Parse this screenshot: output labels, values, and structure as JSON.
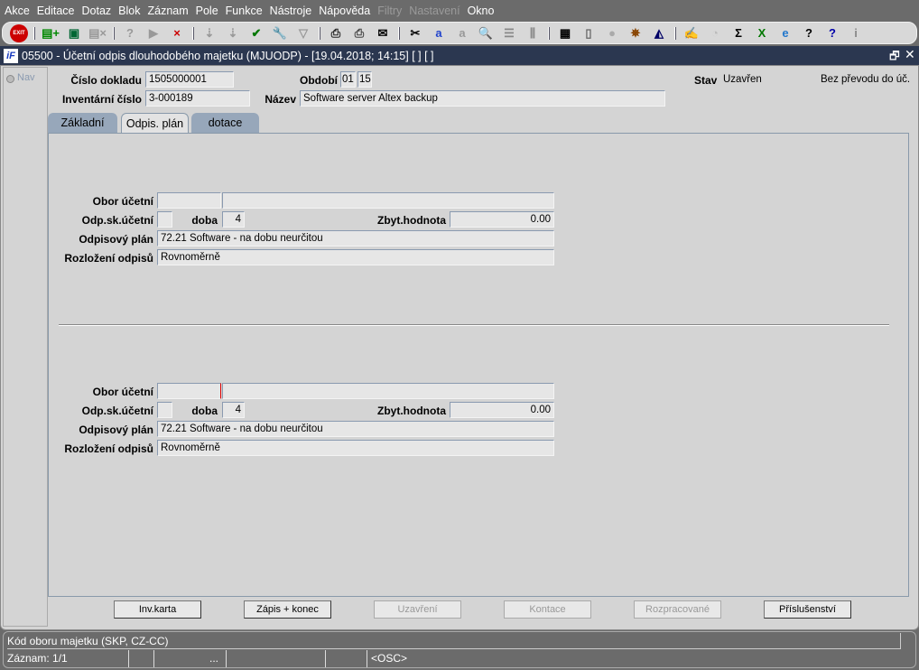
{
  "menu": [
    "Akce",
    "Editace",
    "Dotaz",
    "Blok",
    "Záznam",
    "Pole",
    "Funkce",
    "Nástroje",
    "Nápověda",
    "Filtry",
    "Nastavení",
    "Okno"
  ],
  "toolbar_icons": [
    "exit-icon",
    "sep",
    "insert-record-icon",
    "save-record-icon",
    "delete-record-icon",
    "sep",
    "query-icon",
    "execute-query-icon",
    "cancel-query-icon",
    "sep",
    "sort-asc-icon",
    "sort-desc-icon",
    "check-icon",
    "wrench-icon",
    "filter-icon",
    "sep",
    "print-icon",
    "print-preview-icon",
    "email-icon",
    "sep",
    "cut-icon",
    "copy-icon",
    "paste-icon",
    "find-icon",
    "indent-icon",
    "columns-icon",
    "sep",
    "export-icon",
    "document-icon",
    "globe-icon",
    "wheel-icon",
    "eye-icon",
    "sep",
    "sign-icon",
    "clock-icon",
    "sum-icon",
    "excel-icon",
    "ie-icon",
    "help-icon",
    "help-window-icon",
    "info-icon"
  ],
  "window": {
    "title": "05500 - Účetní odpis dlouhodobého majetku (MJUODP) - [19.04.2018; 14:15]  [ ] [ ]",
    "nav": "Nav"
  },
  "header": {
    "cislo_label": "Číslo dokladu",
    "cislo": "1505000001",
    "obdobi_label": "Období",
    "obdobi_m": "01",
    "obdobi_y": "15",
    "stav_label": "Stav",
    "stav": "Uzavřen",
    "prevod": "Bez převodu do úč.",
    "inv_label": "Inventární číslo",
    "inv": "3-000189",
    "nazev_label": "Název",
    "nazev": "Software server Altex backup"
  },
  "tabs": [
    "Základní",
    "Odpis. plán",
    "dotace"
  ],
  "blocks": [
    {
      "obor_label": "Obor účetní",
      "obor1": "",
      "obor2": "",
      "odpsk_label": "Odp.sk.účetní",
      "odpsk": "",
      "doba_label": "doba",
      "doba": "4",
      "zbyt_label": "Zbyt.hodnota",
      "zbyt": "0.00",
      "plan_label": "Odpisový plán",
      "plan": "72.21 Software - na dobu neurčitou",
      "rozl_label": "Rozložení odpisů",
      "rozl": "Rovnoměrně"
    },
    {
      "obor_label": "Obor účetní",
      "obor1": "",
      "obor2": "",
      "odpsk_label": "Odp.sk.účetní",
      "odpsk": "",
      "doba_label": "doba",
      "doba": "4",
      "zbyt_label": "Zbyt.hodnota",
      "zbyt": "0.00",
      "plan_label": "Odpisový plán",
      "plan": "72.21 Software - na dobu neurčitou",
      "rozl_label": "Rozložení odpisů",
      "rozl": "Rovnoměrně"
    }
  ],
  "buttons": [
    {
      "label": "Inv.karta",
      "enabled": true
    },
    {
      "label": "Zápis + konec",
      "enabled": true
    },
    {
      "label": "Uzavření",
      "enabled": false
    },
    {
      "label": "Kontace",
      "enabled": false
    },
    {
      "label": "Rozpracované",
      "enabled": false
    },
    {
      "label": "Příslušenství",
      "enabled": true
    }
  ],
  "status": {
    "hint": "Kód oboru majetku (SKP, CZ-CC)",
    "record": "Záznam: 1/1",
    "dots": "...",
    "mode": "<OSC>"
  }
}
